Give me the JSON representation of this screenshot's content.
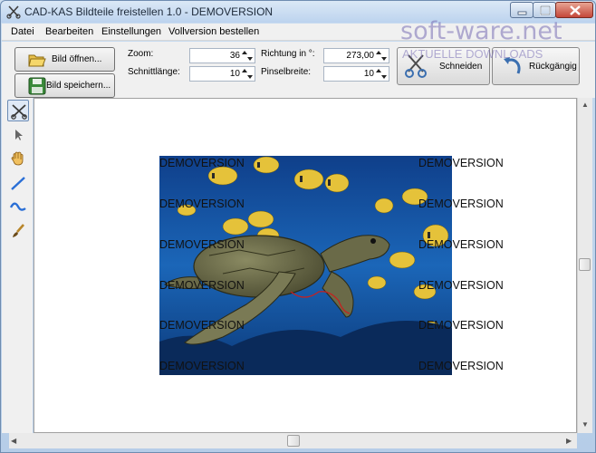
{
  "window": {
    "title": "CAD-KAS Bildteile freistellen 1.0 - DEMOVERSION"
  },
  "menu": [
    "Datei",
    "Bearbeiten",
    "Einstellungen",
    "Vollversion bestellen"
  ],
  "toolbar": {
    "open_label": "Bild öffnen...",
    "save_label": "Bild speichern...",
    "zoom_label": "Zoom:",
    "zoom_value": "36",
    "cut_length_label": "Schnittlänge:",
    "cut_length_value": "10",
    "direction_label": "Richtung in °:",
    "direction_value": "273,00",
    "brush_width_label": "Pinselbreite:",
    "brush_width_value": "10",
    "cut_label": "Schneiden",
    "undo_label": "Rückgängig"
  },
  "watermark": {
    "site": "soft-ware.net",
    "tagline": "AKTUELLE DOWNLOADS"
  },
  "tools": [
    "scissors-icon",
    "arrow-cursor-icon",
    "hand-icon",
    "line-icon",
    "curve-icon",
    "brush-icon"
  ],
  "image_overlay": {
    "demo_text": "DEMOVERSION"
  },
  "colors": {
    "accent": "#3b6fb0",
    "ocean": "#1b5fae",
    "curve": "#2a6fd6"
  }
}
